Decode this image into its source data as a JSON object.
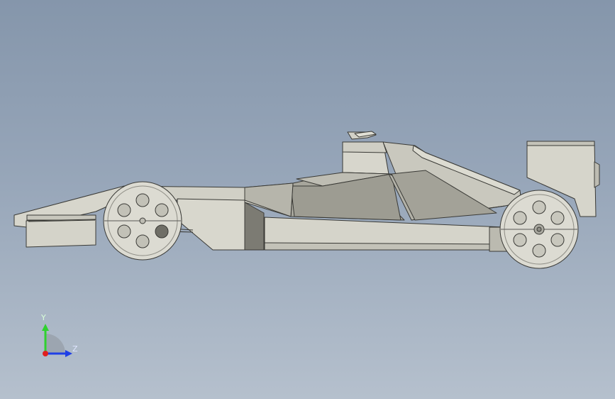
{
  "viewport": {
    "background_top": "#8596ab",
    "background_bottom": "#b5c0cd"
  },
  "model": {
    "description_icon": "formula-car-3d-model",
    "body_color": "#d4d3c9",
    "shadow_color": "#a9a89e",
    "edge_color": "#3a3a36",
    "wheel_color": "#dcdbd2"
  },
  "triad": {
    "y_label": "Y",
    "z_label": "Z",
    "y_color": "#2fd12f",
    "z_color": "#1f3fe6",
    "x_color": "#e01e1e"
  }
}
